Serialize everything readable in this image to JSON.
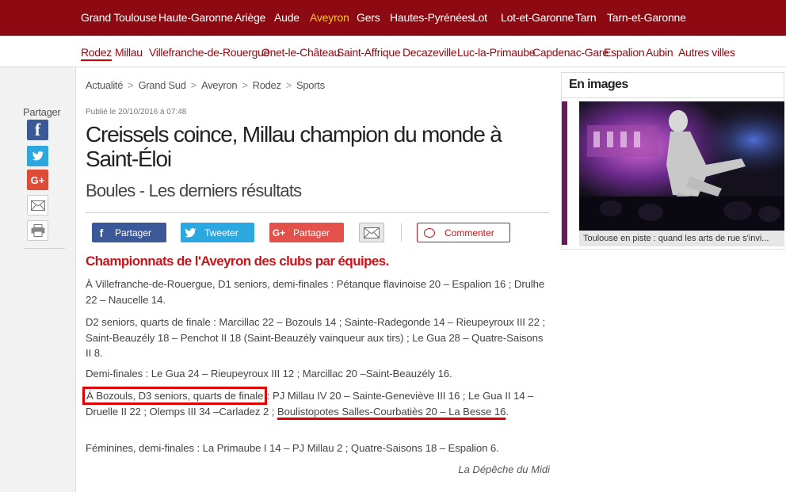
{
  "topnav": [
    "Grand Toulouse",
    "Haute-Garonne",
    "Ariège",
    "Aude",
    "Aveyron",
    "Gers",
    "Hautes-Pyrénées",
    "Lot",
    "Lot-et-Garonne",
    "Tarn",
    "Tarn-et-Garonne"
  ],
  "topnav_active": "Aveyron",
  "subnav": [
    "Rodez",
    "Millau",
    "Villefranche-de-Rouergue",
    "Onet-le-Château",
    "Saint-Affrique",
    "Decazeville",
    "Luc-la-Primaube",
    "Capdenac-Gare",
    "Espalion",
    "Aubin",
    "Autres villes"
  ],
  "subnav_active": "Rodez",
  "share": {
    "label": "Partager",
    "icons": [
      "facebook-icon",
      "twitter-icon",
      "google-plus-icon",
      "mail-icon",
      "print-icon"
    ]
  },
  "breadcrumb": [
    "Actualité",
    "Grand Sud",
    "Aveyron",
    "Rodez",
    "Sports"
  ],
  "article": {
    "pubdate": "Publié le 20/10/2016 à 07:48",
    "title": "Creissels coince, Millau champion du monde à Saint-Éloi",
    "subtitle": "Boules - Les derniers résultats",
    "buttons": {
      "facebook": "Partager",
      "twitter": "Tweeter",
      "googleplus": "Partager",
      "comment": "Commenter"
    },
    "section_title": "Championnats de l'Aveyron des clubs par équipes.",
    "p1": "À Villefranche-de-Rouergue, D1 seniors, demi-finales : Pétanque flavinoise 20 – Espalion 16 ; Drulhe 22 – Naucelle 14.",
    "p2": "D2 seniors, quarts de finale : Marcillac 22 – Bozouls 14 ; Sainte-Radegonde 14 – Rieupeyroux III 22 ; Saint-Beauzély 18 – Penchot II 18 (Saint-Beauzély vainqueur aux tirs) ; Le Gua 28 – Quatre-Saisons II 8.",
    "p3": "Demi-finales : Le Gua 24 – Rieupeyroux III 12 ; Marcillac 20 –Saint-Beauzély 16.",
    "p4_boxed": "À Bozouls, D3 seniors, quarts de finale",
    "p4_middle": " : PJ Millau IV 20 – Sainte-Geneviève III 16 ; Le Gua II 14 – Druelle II 22 ; Olemps III 34 –Carladez 2 ; ",
    "p4_underlined": "Boulistopotes Salles-Courbatiès 20 – La Besse 16",
    "p4_end": ".",
    "p5": "Féminines, demi-finales : La Primaube I 14 – PJ Millau 2 ; Quatre-Saisons 18 – Espalion 6.",
    "source": "La Dépêche du Midi"
  },
  "sidebar": {
    "title": "En images",
    "caption": "Toulouse en piste : quand les arts de rue s'invi..."
  },
  "colors": {
    "brand": "#8e0a12",
    "active_nav": "#f6c431",
    "accent": "#c8151b",
    "annotation": "#e00000"
  }
}
